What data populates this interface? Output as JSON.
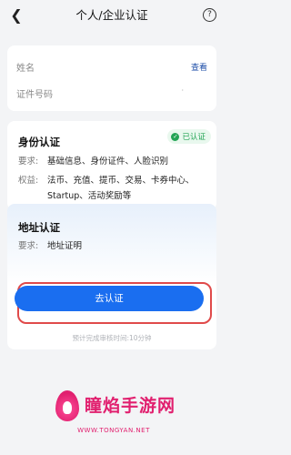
{
  "header": {
    "back_icon": "chevron-left-icon",
    "title": "个人/企业认证",
    "help_icon": "question-circle-icon"
  },
  "info_card": {
    "name_label": "姓名",
    "view_link": "查看",
    "id_label": "证件号码",
    "id_value": "·"
  },
  "identity": {
    "title": "身份认证",
    "badge": "已认证",
    "badge_color": "#23a455",
    "req_key": "要求:",
    "req_value": "基础信息、身份证件、人脸识别",
    "rights_key": "权益:",
    "rights_line1": "法币、充值、提币、交易、卡券中心、",
    "rights_line2": "Startup、活动奖励等"
  },
  "address": {
    "title": "地址认证",
    "req_key": "要求:",
    "req_value": "地址证明",
    "button_label": "去认证",
    "button_color": "#1a6ef0",
    "hint": "预计完成审核时间:10分钟"
  },
  "watermark": {
    "brand": "瞳焰手游网",
    "url": "WWW.TONGYAN.NET",
    "color": "#e1206f"
  }
}
